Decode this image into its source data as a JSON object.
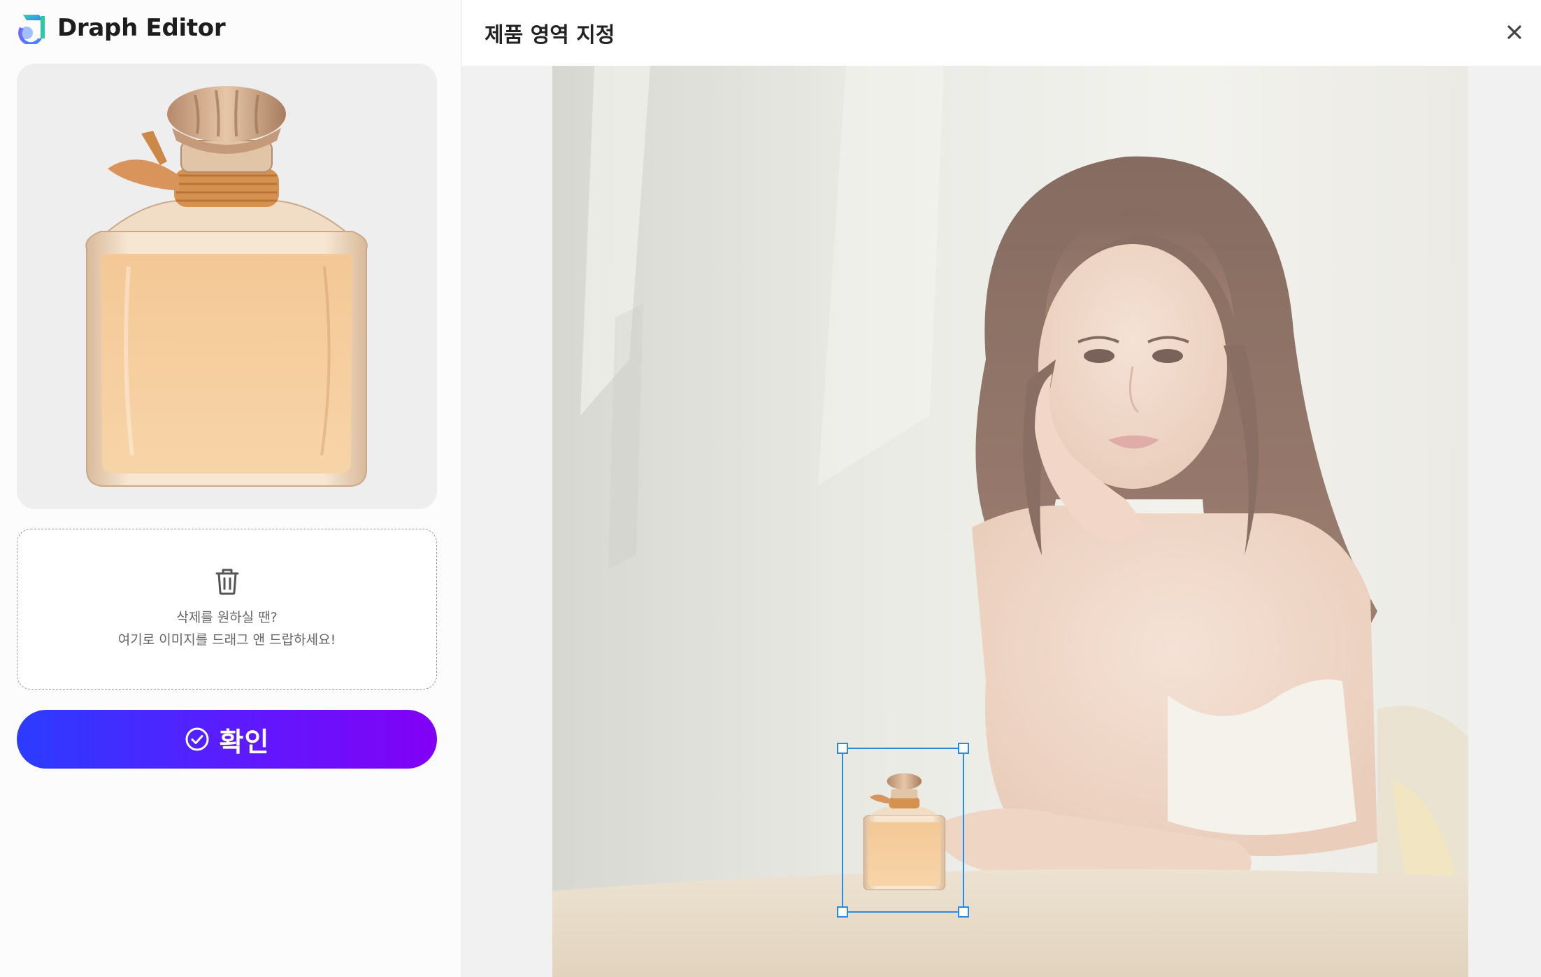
{
  "brand": {
    "name": "Draph Editor",
    "logo_icon": "draph-logo-icon"
  },
  "product": {
    "image": "perfume-bottle-image"
  },
  "dropzone": {
    "icon": "trash-icon",
    "line1": "삭제를 원하실 땐?",
    "line2": "여기로 이미지를 드래그 앤 드랍하세요!"
  },
  "confirm": {
    "label": "확인",
    "icon": "check-circle-icon"
  },
  "panel": {
    "title": "제품 영역 지정",
    "close_icon": "close-icon",
    "canvas_image": "woman-portrait-with-product"
  },
  "colors": {
    "accent_start": "#2b3cff",
    "accent_end": "#8300f5",
    "selection": "#2a8ae2"
  }
}
